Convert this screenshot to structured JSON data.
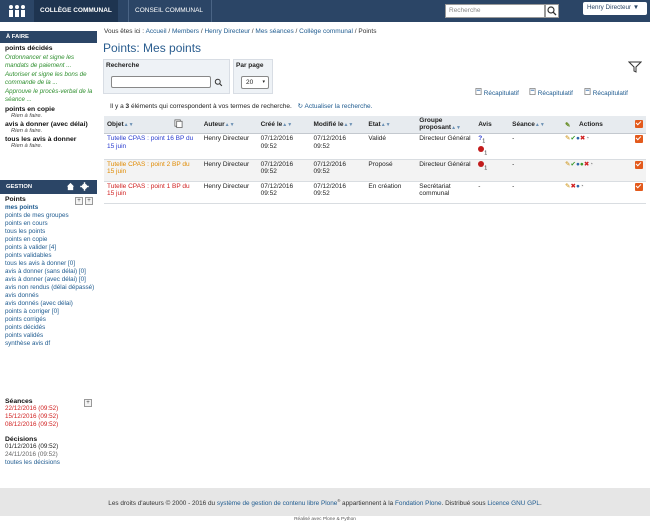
{
  "topbar": {
    "nav": [
      "COLLÈGE COMMUNAL",
      "CONSEIL COMMUNAL"
    ],
    "search_placeholder": "Recherche",
    "user": "Henry Directeur ▼"
  },
  "sidebar": {
    "a_faire_header": "À FAIRE",
    "points_decides": "points décidés",
    "green_items": [
      "Ordonnancer et signe les mandats de paiement ...",
      "Autoriser et signe les bons de commande de la ...",
      "Approuve le procès-verbal de la séance ..."
    ],
    "points_en_copie": "points en copie",
    "rien1": "Rien à faire.",
    "avis_a_donner": "avis à donner (avec délai)",
    "rien2": "Rien à faire.",
    "tous_les_avis": "tous les avis à donner",
    "rien3": "Rien à faire.",
    "gestion_header": "GESTION",
    "points_title": "Points",
    "points_links": [
      "mes points",
      "points de mes groupes",
      "points en cours",
      "tous les points",
      "points en copie",
      "points à valider [4]",
      "points validables",
      "tous les avis à donner [0]",
      "avis à donner (sans délai) [0]",
      "avis à donner (avec délai) [0]",
      "avis non rendus (délai dépassé)",
      "avis donnés",
      "avis donnés (avec délai)",
      "points à corriger [0]",
      "points corrigés",
      "points décidés",
      "points validés",
      "synthèse avis df"
    ],
    "seances_title": "Séances",
    "seances": [
      "22/12/2016 (09:52)",
      "15/12/2016 (09:52)",
      "08/12/2016 (09:52)"
    ],
    "decisions_title": "Décisions",
    "decisions": [
      "01/12/2016 (09:52)",
      "24/11/2016 (09:52)",
      "toutes les décisions"
    ]
  },
  "main": {
    "breadcrumb_prefix": "Vous êtes ici :",
    "breadcrumb": [
      "Accueil",
      "Members",
      "Henry Directeur",
      "Mes séances",
      "Collège communal",
      "Points"
    ],
    "title": "Points: Mes points",
    "recherche_label": "Recherche",
    "par_page_label": "Par page",
    "par_page_value": "20",
    "results_pre": "Il y a ",
    "results_count": "3",
    "results_post": " éléments qui correspondent à vos termes de recherche.",
    "refresh": "Actualiser la recherche.",
    "recap": [
      "Récapitulatif",
      "Récapitulatif",
      "Récapitulatif"
    ],
    "columns": [
      "Objet",
      "Auteur",
      "Créé le",
      "Modifié le",
      "Etat",
      "Groupe proposant",
      "Avis",
      "Séance",
      "Actions"
    ],
    "rows": [
      {
        "objet": "Tutelle CPAS : point 16 BP du 15 juin",
        "auteur": "Henry Directeur",
        "cree": "07/12/2016 09:52",
        "modifie": "07/12/2016 09:52",
        "etat": "Validé",
        "groupe": "Directeur Général",
        "seance": "-"
      },
      {
        "objet": "Tutelle CPAS : point 2 BP du 15 juin",
        "auteur": "Henry Directeur",
        "cree": "07/12/2016 09:52",
        "modifie": "07/12/2016 09:52",
        "etat": "Proposé",
        "groupe": "Directeur Général",
        "seance": "-"
      },
      {
        "objet": "Tutelle CPAS : point 1 BP du 15 juin",
        "auteur": "Henry Directeur",
        "cree": "07/12/2016 09:52",
        "modifie": "07/12/2016 09:52",
        "etat": "En création",
        "groupe": "Secrétariat communal",
        "seance": "-"
      }
    ],
    "avis_row1": "?",
    "avis_row1_count1": "1",
    "avis_row1_count2": "1",
    "avis_row2_count": "1",
    "avis_row3": "-"
  },
  "footer": {
    "text1": "Les droits d'auteurs © 2000 - 2016 du ",
    "link1": "système de gestion de contenu libre Plone",
    "text2": " appartiennent à la ",
    "link2": "Fondation Plone",
    "text3": ". Distribué sous ",
    "link3": "Licence GNU GPL",
    "text4": ".",
    "powered": "Réalisé avec Plone & Python"
  },
  "colors": {
    "header": "#2b4566",
    "link": "#205c90",
    "green": "#2f8f2f",
    "red": "#d02020",
    "orange": "#e08a00",
    "check": "#e35a1c"
  }
}
